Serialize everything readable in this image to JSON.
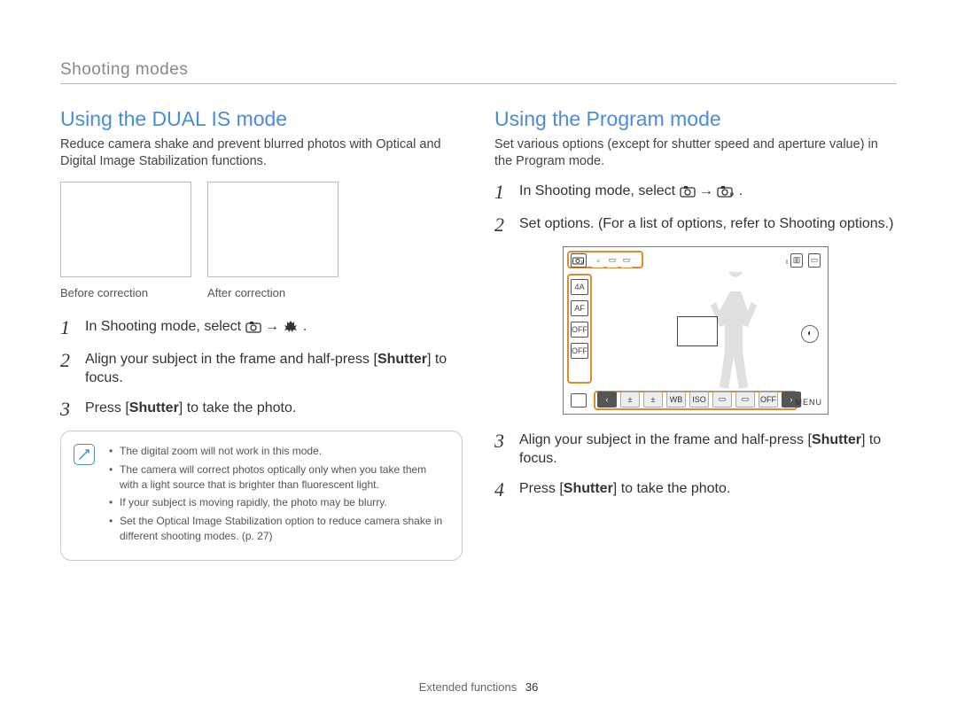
{
  "header": {
    "section": "Shooting modes"
  },
  "left": {
    "title": "Using the DUAL IS mode",
    "intro": "Reduce camera shake and prevent blurred photos with Optical and Digital Image Stabilization functions.",
    "captions": {
      "before": "Before correction",
      "after": "After correction"
    },
    "steps": {
      "s1_a": "In Shooting mode, select ",
      "s1_b": " → ",
      "s1_c": ".",
      "s2_a": "Align your subject in the frame and half-press [",
      "s2_b": "Shutter",
      "s2_c": "] to focus.",
      "s3_a": "Press [",
      "s3_b": "Shutter",
      "s3_c": "] to take the photo."
    },
    "note": {
      "n1": "The digital zoom will not work in this mode.",
      "n2": "The camera will correct photos optically only when you take them with a light source that is brighter than fluorescent light.",
      "n3": "If your subject is moving rapidly, the photo may be blurry.",
      "n4": "Set the Optical Image Stabilization option to reduce camera shake in different shooting modes. (p. 27)"
    }
  },
  "right": {
    "title": "Using the Program mode",
    "intro": "Set various options (except for shutter speed and aperture value) in the Program mode.",
    "steps": {
      "s1_a": "In Shooting mode, select ",
      "s1_b": " → ",
      "s1_c": ".",
      "s2_a": "Set options. (For a list of options, refer to ",
      "s2_b": "Shooting options.",
      "s2_c": ")",
      "s3_a": "Align your subject in the frame and half-press [",
      "s3_b": "Shutter",
      "s3_c": "] to focus.",
      "s4_a": "Press [",
      "s4_b": "Shutter",
      "s4_c": "] to take the photo."
    },
    "screen": {
      "mode": "P",
      "side": [
        "4A",
        "AF",
        "OFF",
        "OFF"
      ],
      "bottom_labels": [
        "‹",
        "±",
        "±",
        "WB",
        "ISO",
        "▭",
        "▭",
        "OFF",
        "›"
      ],
      "menu": "MENU"
    }
  },
  "footer": {
    "chapter": "Extended functions",
    "page": "36"
  }
}
